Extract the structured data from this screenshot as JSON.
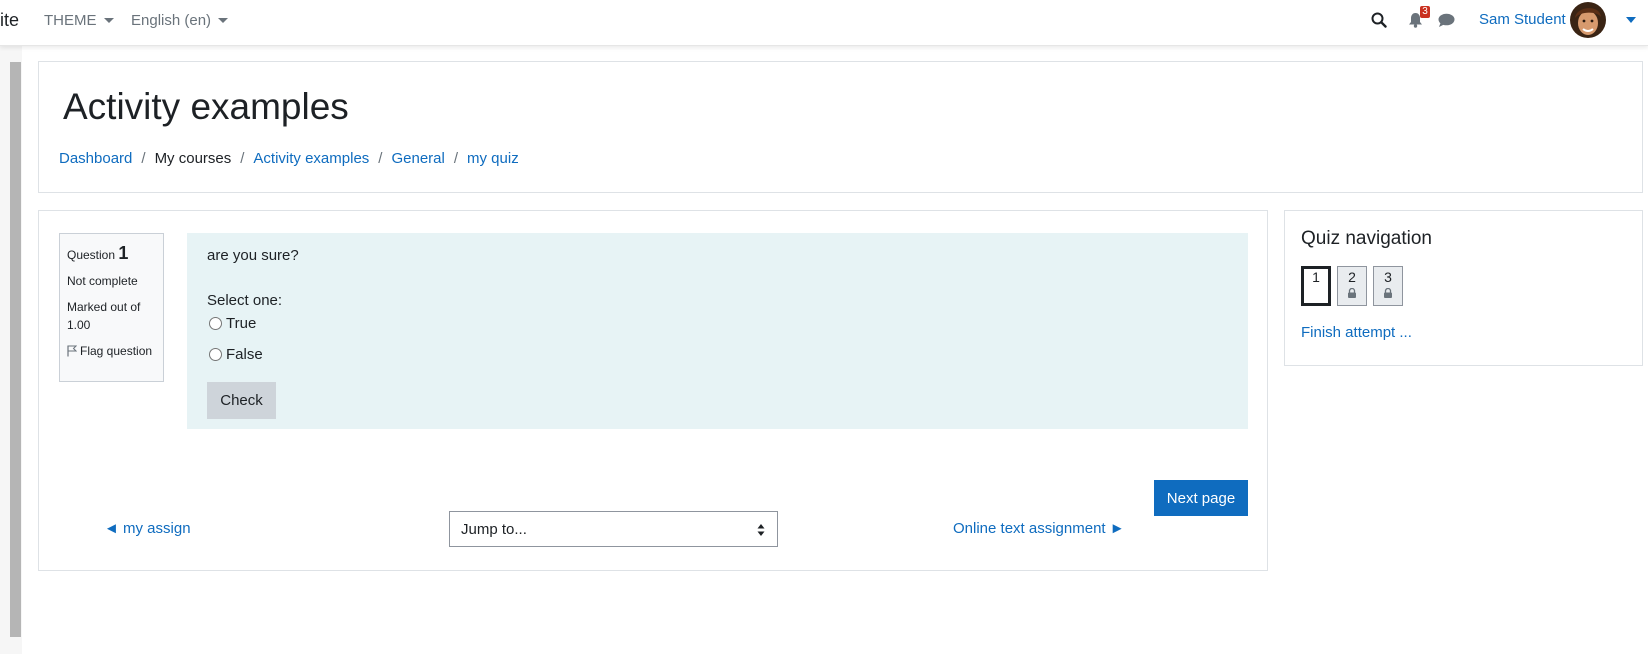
{
  "navbar": {
    "brand": "ite",
    "theme_label": "THEME",
    "language_label": "English (en)",
    "notification_count": "3",
    "user_name": "Sam Student"
  },
  "header": {
    "title": "Activity examples",
    "breadcrumb": [
      "Dashboard",
      "My courses",
      "Activity examples",
      "General",
      "my quiz"
    ]
  },
  "question": {
    "label": "Question",
    "number": "1",
    "status": "Not complete",
    "marked_out_of": "Marked out of 1.00",
    "flag_label": "Flag question",
    "text": "are you sure?",
    "select_prompt": "Select one:",
    "options": [
      "True",
      "False"
    ],
    "check_label": "Check"
  },
  "navigation": {
    "next_page_label": "Next page",
    "prev_activity": "◄ my assign",
    "jump_placeholder": "Jump to...",
    "next_activity": "Online text assignment ►"
  },
  "quiz_nav": {
    "title": "Quiz navigation",
    "questions": [
      "1",
      "2",
      "3"
    ],
    "current": "1",
    "finish_label": "Finish attempt ..."
  },
  "colors": {
    "link": "#0f6cbf",
    "question_bg": "#e7f3f5",
    "primary_button": "#0f6cbf",
    "badge": "#ca3120"
  }
}
